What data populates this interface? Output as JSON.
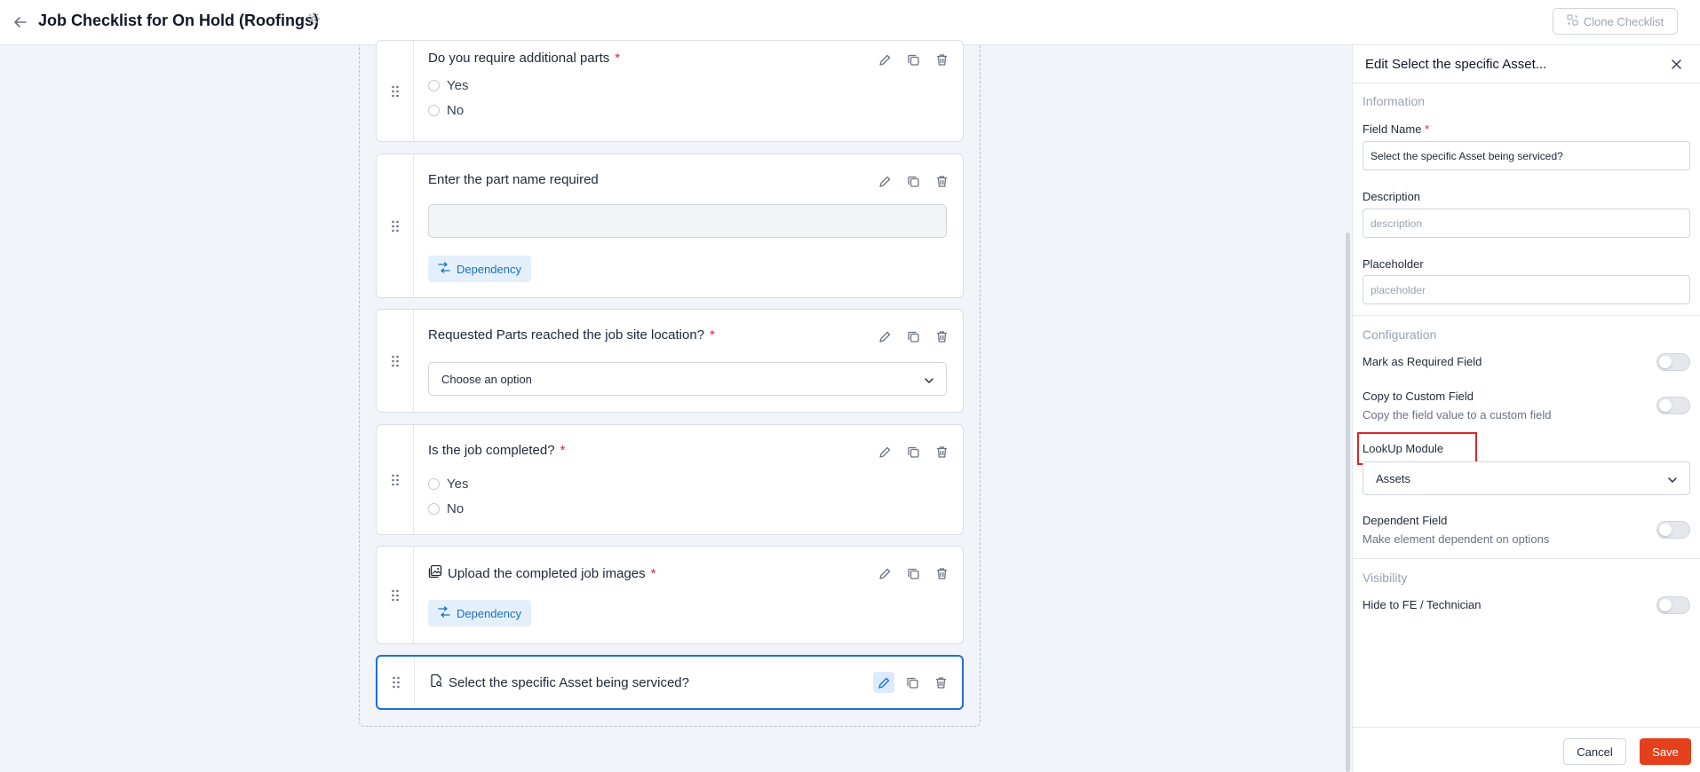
{
  "header": {
    "title": "Job Checklist for On Hold (Roofings)",
    "clone_label": "Clone Checklist"
  },
  "questions": [
    {
      "label": "Do you require additional parts",
      "required": "*",
      "options": [
        "Yes",
        "No"
      ]
    },
    {
      "label": "Enter the part name required",
      "dependency_label": "Dependency"
    },
    {
      "label": "Requested Parts reached the job site location?",
      "required": "*",
      "select_value": "Choose an option"
    },
    {
      "label": "Is the job completed?",
      "required": "*",
      "options": [
        "Yes",
        "No"
      ]
    },
    {
      "label": "Upload the completed job images",
      "required": "*",
      "dependency_label": "Dependency"
    },
    {
      "label": "Select the specific Asset being serviced?"
    }
  ],
  "panel": {
    "title": "Edit Select the specific Asset...",
    "information_heading": "Information",
    "field_name_label": "Field Name",
    "field_name_required": "*",
    "field_name_value": "Select the specific Asset being serviced?",
    "description_label": "Description",
    "description_placeholder": "description",
    "placeholder_label": "Placeholder",
    "placeholder_placeholder": "placeholder",
    "configuration_heading": "Configuration",
    "mark_required_label": "Mark as Required Field",
    "copy_custom_label": "Copy to Custom Field",
    "copy_custom_sub": "Copy the field value to a custom field",
    "lookup_label": "LookUp Module",
    "lookup_value": "Assets",
    "dependent_label": "Dependent Field",
    "dependent_sub": "Make element dependent on options",
    "visibility_heading": "Visibility",
    "hide_label": "Hide to FE / Technician",
    "cancel_label": "Cancel",
    "save_label": "Save"
  },
  "colors": {
    "accent": "#1f6fd1",
    "save": "#e4401b",
    "required": "#e11d48",
    "highlight": "#dc2626"
  }
}
